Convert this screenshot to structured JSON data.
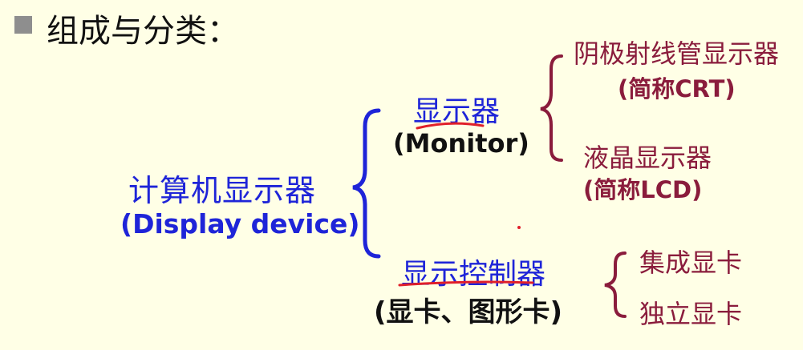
{
  "heading": {
    "text": "组成与分类："
  },
  "root": {
    "cn": "计算机显示器",
    "en": "(Display device)"
  },
  "monitor": {
    "cn": "显示器",
    "en": "(Monitor)"
  },
  "crt": {
    "cn": "阴极射线管显示器",
    "en": "(简称CRT)"
  },
  "lcd": {
    "cn": "液晶显示器",
    "en": "(简称LCD)"
  },
  "controller": {
    "cn": "显示控制器",
    "sub": "(显卡、图形卡)"
  },
  "integrated": {
    "cn": "集成显卡"
  },
  "discrete": {
    "cn": "独立显卡"
  },
  "colors": {
    "blue": "#1e24d8",
    "maroon": "#8a1c3c",
    "black": "#111111",
    "red": "#e0202a",
    "background": "#ffffe6"
  }
}
